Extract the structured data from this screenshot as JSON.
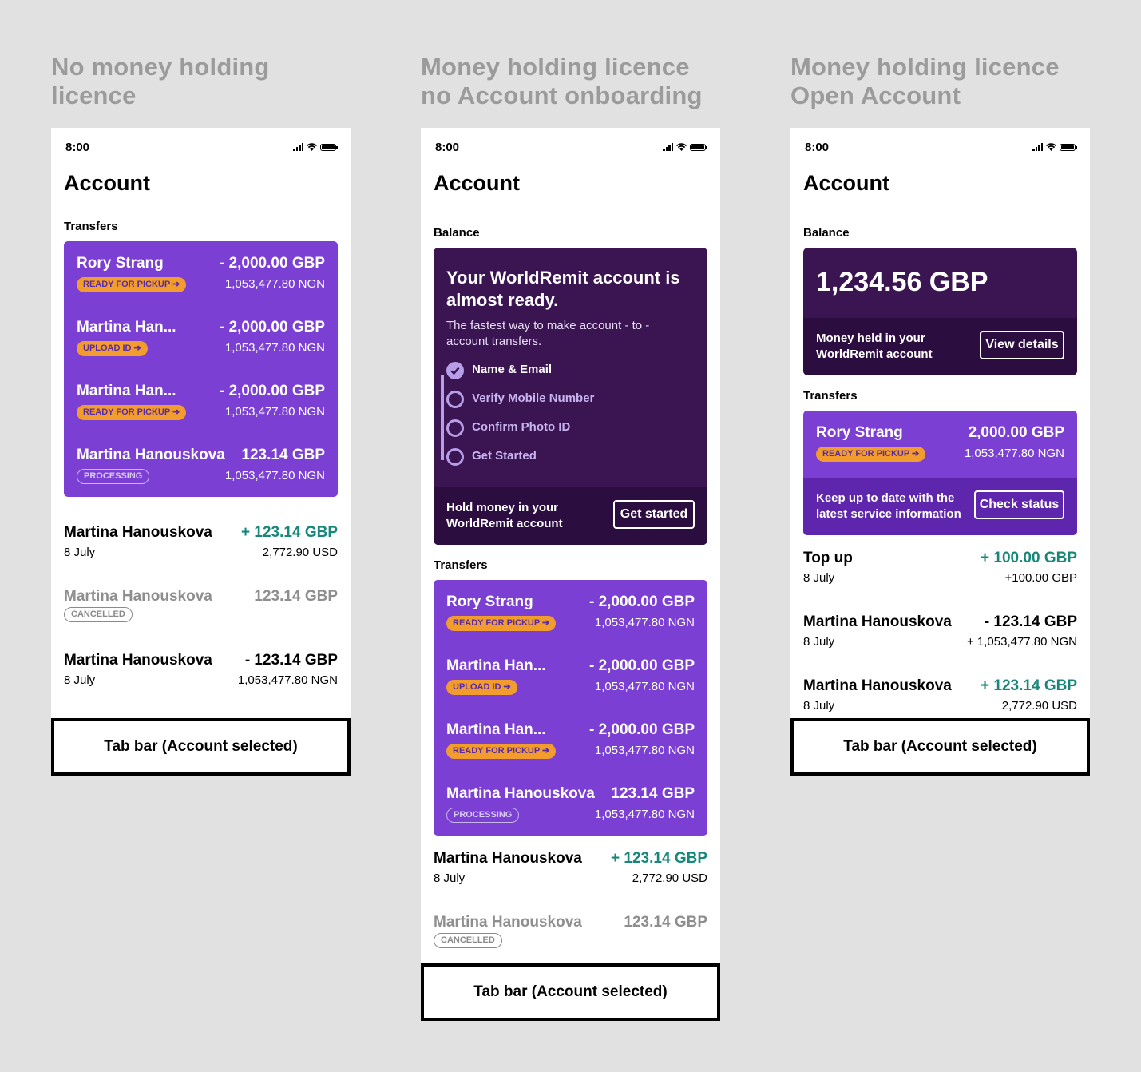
{
  "columns": [
    {
      "title_line1": "No money holding",
      "title_line2": "licence"
    },
    {
      "title_line1": "Money holding licence",
      "title_line2": "no Account onboarding"
    },
    {
      "title_line1": "Money holding licence",
      "title_line2": "Open Account"
    }
  ],
  "status_time": "8:00",
  "page_title": "Account",
  "labels": {
    "transfers": "Transfers",
    "balance": "Balance"
  },
  "tabbar": "Tab bar (Account selected)",
  "transfers_card": [
    {
      "name": "Rory Strang",
      "amount": "- 2,000.00 GBP",
      "sub": "1,053,477.80 NGN",
      "pill": "READY FOR PICKUP ➔"
    },
    {
      "name": "Martina Han...",
      "amount": "- 2,000.00 GBP",
      "sub": "1,053,477.80 NGN",
      "pill": "UPLOAD ID ➔"
    },
    {
      "name": "Martina Han...",
      "amount": "- 2,000.00 GBP",
      "sub": "1,053,477.80 NGN",
      "pill": "READY FOR PICKUP ➔"
    },
    {
      "name": "Martina Hanouskova",
      "amount": "123.14 GBP",
      "sub": "1,053,477.80 NGN",
      "pill": "PROCESSING"
    }
  ],
  "list_a": [
    {
      "name": "Martina Hanouskova",
      "amount": "+ 123.14 GBP",
      "date": "8 July",
      "sub": "2,772.90 USD"
    },
    {
      "name": "Martina Hanouskova",
      "amount": "123.14 GBP",
      "pill": "CANCELLED"
    },
    {
      "name": "Martina Hanouskova",
      "amount": "- 123.14 GBP",
      "date": "8 July",
      "sub": "1,053,477.80 NGN"
    }
  ],
  "onboarding": {
    "title": "Your WorldRemit account is almost ready.",
    "desc": "The fastest way to make account - to - account transfers.",
    "steps": [
      "Name & Email",
      "Verify Mobile Number",
      "Confirm Photo ID",
      "Get Started"
    ],
    "footer_text": "Hold money in your WorldRemit account",
    "button": "Get started"
  },
  "list_b": [
    {
      "name": "Martina Hanouskova",
      "amount": "+ 123.14 GBP",
      "date": "8 July",
      "sub": "2,772.90 USD"
    },
    {
      "name": "Martina Hanouskova",
      "amount": "123.14 GBP",
      "pill": "CANCELLED"
    }
  ],
  "balance_card": {
    "amount": "1,234.56 GBP",
    "footer_text": "Money held in your WorldRemit account",
    "button": "View details"
  },
  "transfer_c": {
    "name": "Rory Strang",
    "amount": "2,000.00 GBP",
    "sub": "1,053,477.80 NGN",
    "pill": "READY FOR PICKUP ➔",
    "footer_text": "Keep up to date with the latest service information",
    "button": "Check status"
  },
  "list_c": [
    {
      "name": "Top up",
      "amount": "+ 100.00 GBP",
      "date": "8 July",
      "sub": "+100.00 GBP"
    },
    {
      "name": "Martina Hanouskova",
      "amount": "- 123.14 GBP",
      "date": "8 July",
      "sub": "+ 1,053,477.80 NGN"
    },
    {
      "name": "Martina Hanouskova",
      "amount": "+ 123.14 GBP",
      "date": "8 July",
      "sub": "2,772.90 USD"
    }
  ],
  "colors": {
    "purple": "#7b3fd4",
    "dark_purple": "#3b1452",
    "orange": "#f39c2e",
    "green": "#17877a"
  }
}
